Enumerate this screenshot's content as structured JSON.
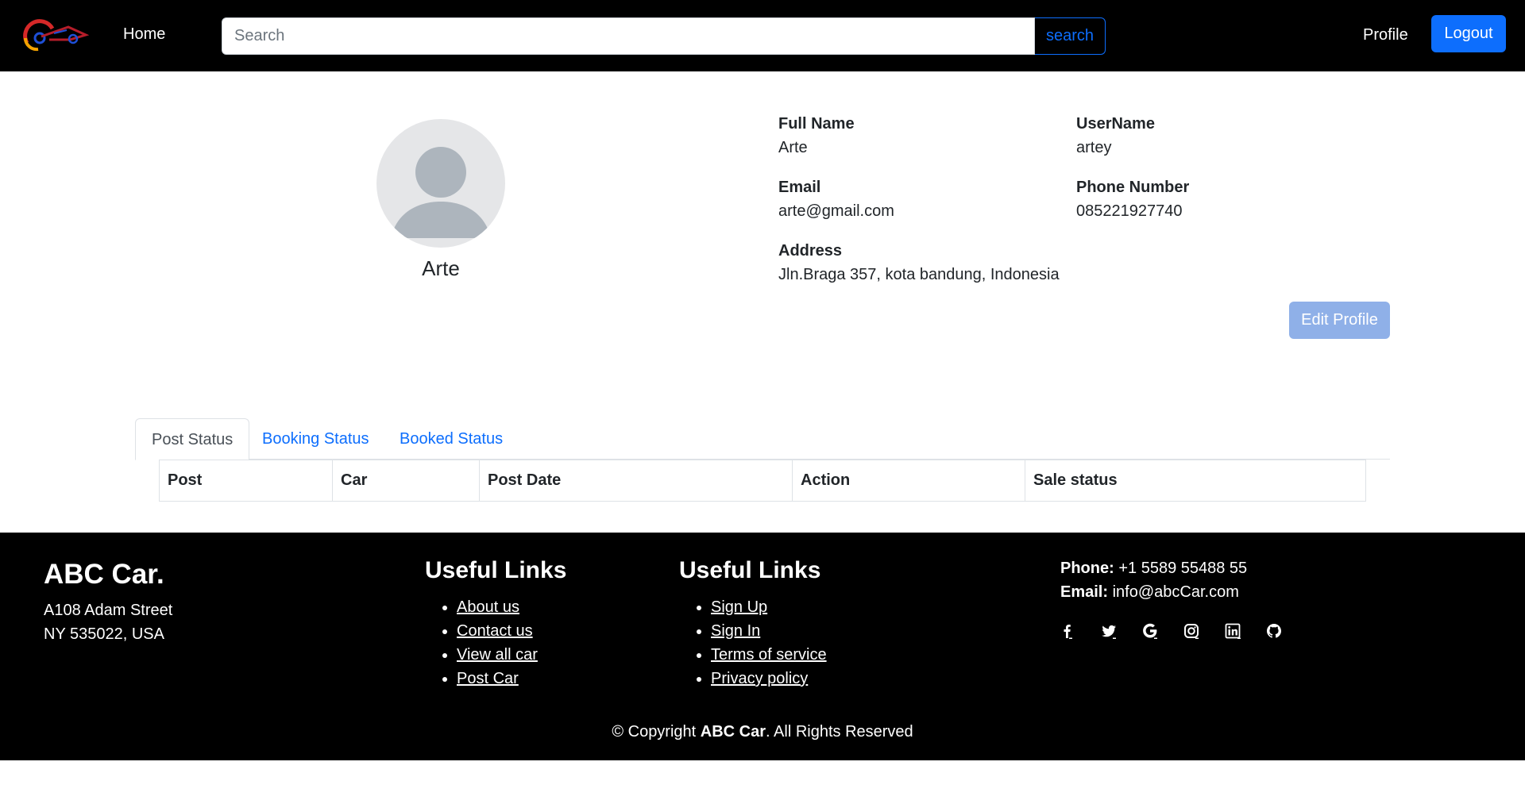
{
  "navbar": {
    "home_label": "Home",
    "search_placeholder": "Search",
    "search_button": "search",
    "profile_label": "Profile",
    "logout_label": "Logout",
    "logo_icon": "car-logo-icon"
  },
  "profile": {
    "name": "Arte",
    "avatar_icon": "user-avatar-icon",
    "fields": {
      "full_name": {
        "label": "Full Name",
        "value": "Arte"
      },
      "username": {
        "label": "UserName",
        "value": "artey"
      },
      "email": {
        "label": "Email",
        "value": "arte@gmail.com"
      },
      "phone": {
        "label": "Phone Number",
        "value": "085221927740"
      },
      "address": {
        "label": "Address",
        "value": "Jln.Braga 357, kota bandung, Indonesia"
      }
    },
    "edit_button": "Edit Profile"
  },
  "tabs": [
    {
      "label": "Post Status",
      "active": true
    },
    {
      "label": "Booking Status",
      "active": false
    },
    {
      "label": "Booked Status",
      "active": false
    }
  ],
  "table": {
    "headers": [
      "Post",
      "Car",
      "Post Date",
      "Action",
      "Sale status"
    ],
    "rows": []
  },
  "footer": {
    "brand": "ABC Car.",
    "address_line1": "A108 Adam Street",
    "address_line2": "NY 535022, USA",
    "links_col1": {
      "heading": "Useful Links",
      "items": [
        "About us",
        "Contact us",
        "View all car",
        "Post Car"
      ]
    },
    "links_col2": {
      "heading": "Useful Links",
      "items": [
        "Sign Up",
        "Sign In",
        "Terms of service",
        "Privacy policy"
      ]
    },
    "phone_label": "Phone:",
    "phone_value": "+1 5589 55488 55",
    "email_label": "Email:",
    "email_value": "info@abcCar.com",
    "socials": [
      "facebook-icon",
      "twitter-icon",
      "google-icon",
      "instagram-icon",
      "linkedin-icon",
      "github-icon"
    ],
    "copyright_prefix": "© Copyright",
    "copyright_brand": "ABC Car",
    "copyright_suffix": ". All Rights Reserved"
  },
  "colors": {
    "primary": "#0d6efd",
    "edit_button": "#8fb0e8",
    "navbar_bg": "#000000",
    "footer_bg": "#000000",
    "avatar_bg": "#e5e6e8",
    "avatar_fg": "#adb5bd"
  }
}
